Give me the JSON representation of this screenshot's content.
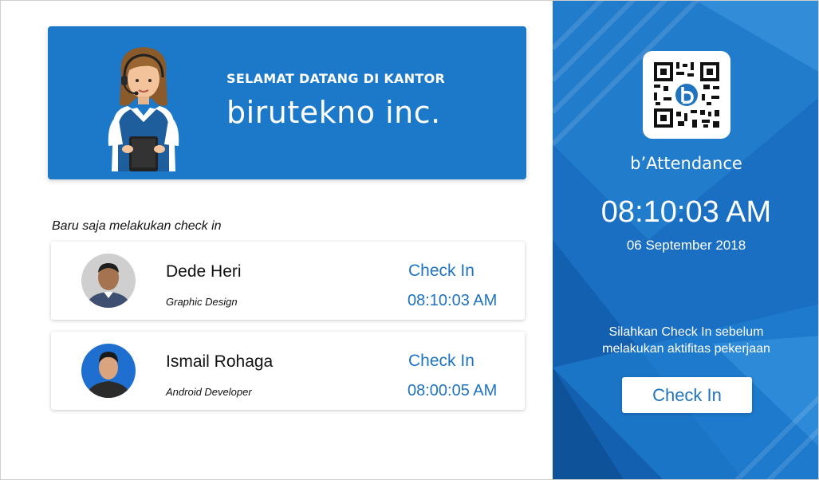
{
  "banner": {
    "subtitle": "SELAMAT DATANG DI KANTOR",
    "company": "birutekno inc.",
    "color": "#1c78c8"
  },
  "recent": {
    "title": "Baru saja melakukan check in",
    "entries": [
      {
        "name": "Dede Heri",
        "role": "Graphic Design",
        "status": "Check In",
        "time": "08:10:03 AM"
      },
      {
        "name": "Ismail Rohaga",
        "role": "Android Developer",
        "status": "Check In",
        "time": "08:00:05 AM"
      }
    ]
  },
  "side": {
    "app_name": "b’Attendance",
    "clock": "08:10:03 AM",
    "date": "06 September 2018",
    "hint": "Silahkan Check In sebelum melakukan aktifitas pekerjaan",
    "button_label": "Check In",
    "panel_color": "#1a6fc2",
    "accent_color": "#1f73bf"
  },
  "icons": {
    "qr": "qr-code-icon",
    "mascot": "receptionist-illustration",
    "avatar": "avatar-photo"
  }
}
